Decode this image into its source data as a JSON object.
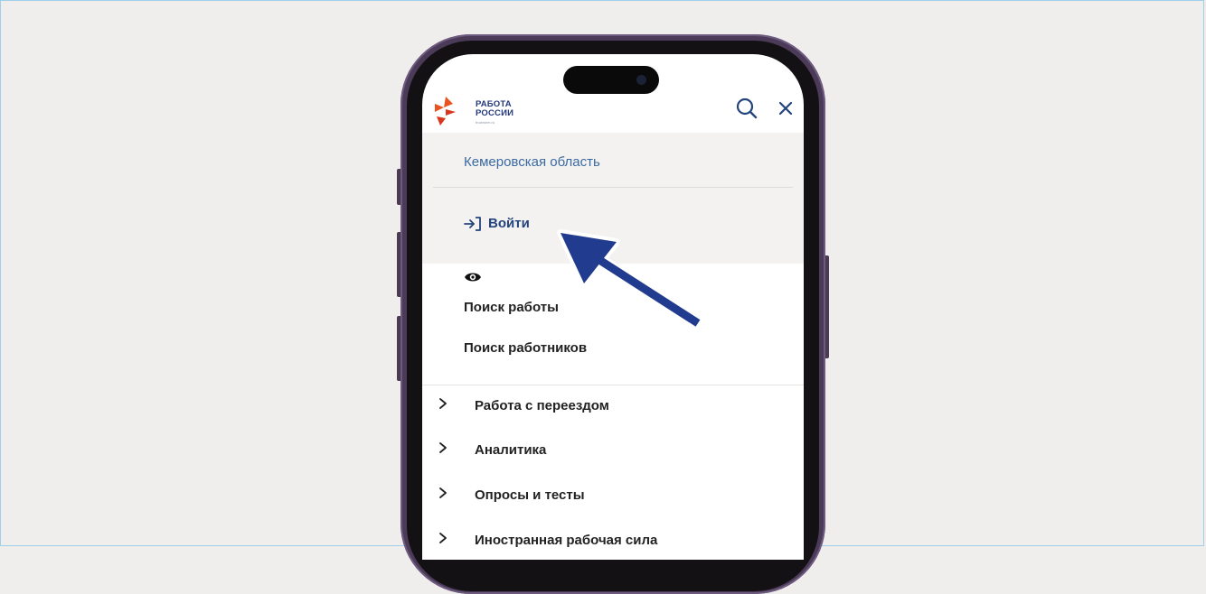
{
  "header": {
    "logo_line1": "РАБОТА",
    "logo_line2": "РОССИИ",
    "logo_site": "trudvsem.ru",
    "search_icon": "search-icon",
    "close_icon": "close-icon"
  },
  "region": "Кемеровская область",
  "login_label": "Войти",
  "accessibility_icon": "eye-icon",
  "menu_plain": [
    "Поиск работы",
    "Поиск работников"
  ],
  "menu_expandable": [
    "Работа с переездом",
    "Аналитика",
    "Опросы и тесты",
    "Иностранная рабочая сила"
  ],
  "colors": {
    "brand_blue": "#24387a",
    "link_blue": "#3b6aa0",
    "logo_orange": "#e8531f",
    "logo_red": "#d8361e",
    "arrow_blue": "#213b8f",
    "phone_frame": "#4b3a58"
  }
}
